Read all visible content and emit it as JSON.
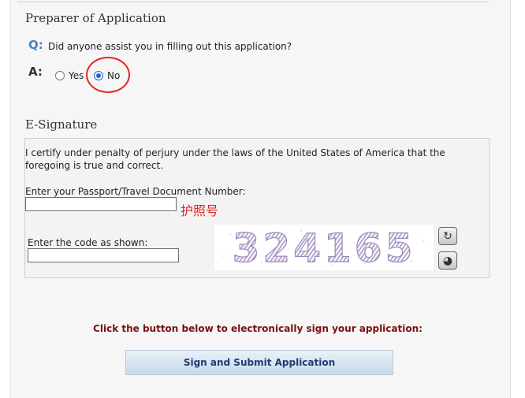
{
  "preparer": {
    "heading": "Preparer of Application",
    "q_letter": "Q:",
    "question": "Did anyone assist you in filling out this application?",
    "a_letter": "A:",
    "options": [
      {
        "label": "Yes",
        "checked": false
      },
      {
        "label": "No",
        "checked": true
      }
    ]
  },
  "esignature": {
    "heading": "E-Signature",
    "certify_line1": "I certify under penalty of perjury under the laws of the United States of America that the",
    "certify_line2": "foregoing is true and correct.",
    "passport_label": "Enter your Passport/Travel Document Number:",
    "passport_value": "",
    "passport_note": "护照号",
    "code_label": "Enter the code as shown:",
    "code_value": "",
    "captcha_text": "324165"
  },
  "submit": {
    "instruction": "Click the button below to electronically sign your application:",
    "button_label": "Sign and Submit Application"
  },
  "colors": {
    "annotation": "#e1261c",
    "radio_selected": "#1a64d6",
    "instruction": "#7a1010",
    "question_letter": "#4a7fc1"
  }
}
